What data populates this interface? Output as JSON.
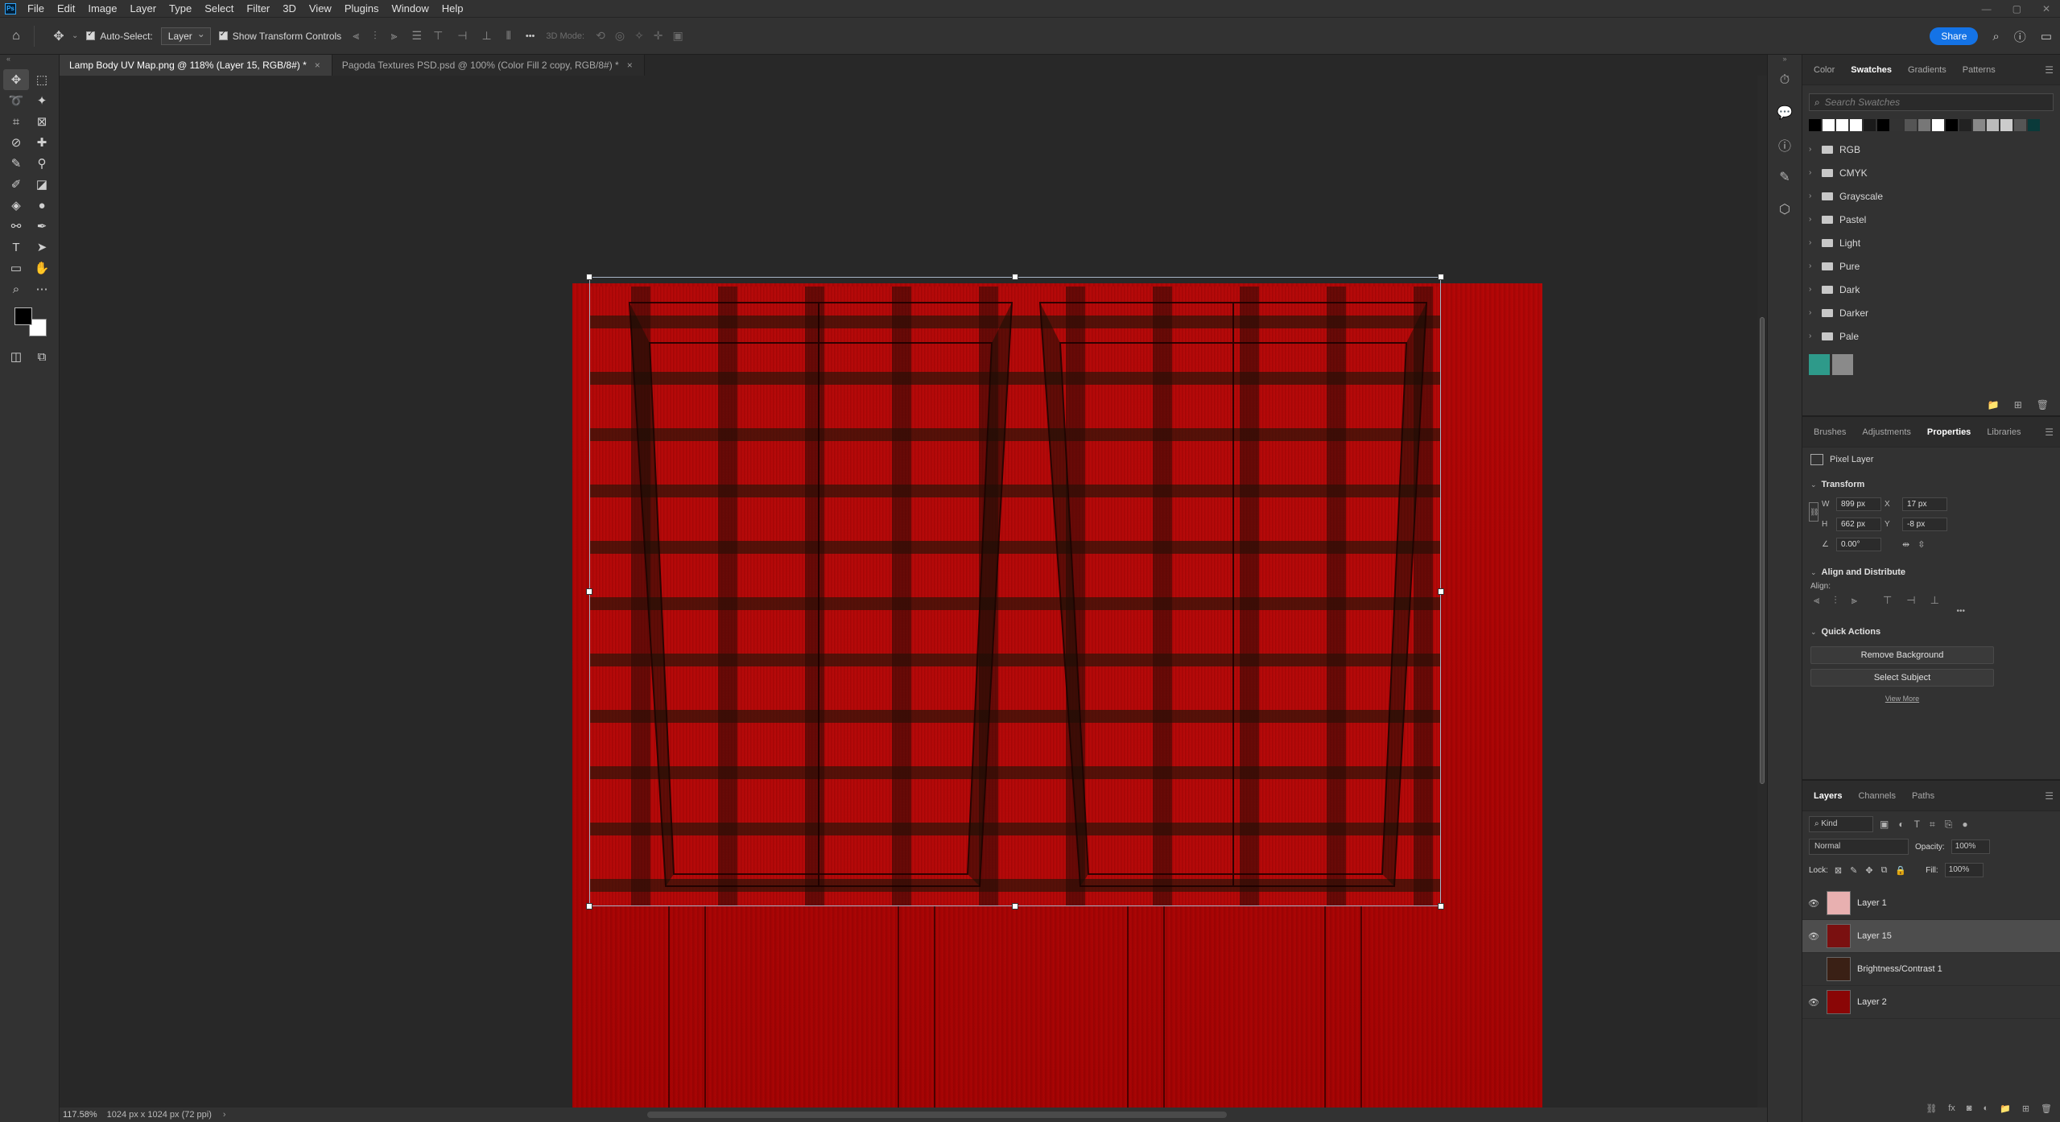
{
  "app": {
    "logo": "Ps"
  },
  "menu": [
    "File",
    "Edit",
    "Image",
    "Layer",
    "Type",
    "Select",
    "Filter",
    "3D",
    "View",
    "Plugins",
    "Window",
    "Help"
  ],
  "window_controls": [
    "—",
    "▢",
    "✕"
  ],
  "options": {
    "auto_select_label": "Auto-Select:",
    "auto_select_target": "Layer",
    "show_transform_label": "Show Transform Controls",
    "mode_3d_label": "3D Mode:",
    "more": "•••",
    "share_label": "Share"
  },
  "tabs": [
    {
      "label": "Lamp Body UV Map.png @ 118% (Layer 15, RGB/8#) *",
      "close": "×"
    },
    {
      "label": "Pagoda Textures PSD.psd @ 100% (Color Fill 2 copy, RGB/8#) *",
      "close": "×"
    }
  ],
  "status": {
    "zoom": "117.58%",
    "doc_info": "1024 px x 1024 px (72 ppi)",
    "arrow": "›"
  },
  "swatches_panel": {
    "tabs": [
      "Color",
      "Swatches",
      "Gradients",
      "Patterns"
    ],
    "active_tab": "Swatches",
    "search_placeholder": "Search Swatches",
    "recent_colors": [
      "#000000",
      "#ffffff",
      "#ffffff",
      "#ffffff",
      "#1a1a1a",
      "#000000",
      "#333333",
      "#555555",
      "#777777",
      "#ffffff",
      "#000000",
      "#222222",
      "#888888",
      "#bbbbbb",
      "#cccccc",
      "#555555",
      "#0a3a3a"
    ],
    "groups": [
      "RGB",
      "CMYK",
      "Grayscale",
      "Pastel",
      "Light",
      "Pure",
      "Dark",
      "Darker",
      "Pale"
    ],
    "custom_colors": [
      "#2e9a8a",
      "#8a8a8a"
    ]
  },
  "properties_panel": {
    "tabs": [
      "Brushes",
      "Adjustments",
      "Properties",
      "Libraries"
    ],
    "active_tab": "Properties",
    "layer_type": "Pixel Layer",
    "transform_title": "Transform",
    "w_label": "W",
    "w": "899 px",
    "h_label": "H",
    "h": "662 px",
    "x_label": "X",
    "x": "17 px",
    "y_label": "Y",
    "y": "-8 px",
    "angle": "0.00°",
    "align_title": "Align and Distribute",
    "align_label": "Align:",
    "more": "•••",
    "quick_actions_title": "Quick Actions",
    "remove_bg": "Remove Background",
    "select_subject": "Select Subject",
    "view_more": "View More"
  },
  "layers_panel": {
    "tabs": [
      "Layers",
      "Channels",
      "Paths"
    ],
    "active_tab": "Layers",
    "kind_label": "Kind",
    "blend_mode": "Normal",
    "opacity_label": "Opacity:",
    "opacity": "100%",
    "lock_label": "Lock:",
    "fill_label": "Fill:",
    "fill": "100%",
    "layers": [
      {
        "name": "Layer 1",
        "visible": true,
        "selected": false,
        "thumb": "#e8b0b0"
      },
      {
        "name": "Layer 15",
        "visible": true,
        "selected": true,
        "thumb": "#7a1010"
      },
      {
        "name": "Brightness/Contrast 1",
        "visible": false,
        "selected": false,
        "thumb": "#3a2015"
      },
      {
        "name": "Layer 2",
        "visible": true,
        "selected": false,
        "thumb": "#8a0606"
      }
    ]
  }
}
